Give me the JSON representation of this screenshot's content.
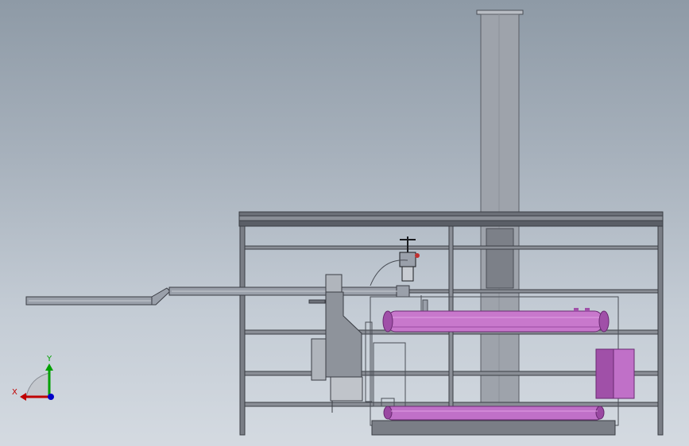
{
  "triad": {
    "x_label": "X",
    "y_label": "Y",
    "x_color": "#c00000",
    "y_color": "#00a000",
    "z_color": "#0000c8"
  },
  "colors": {
    "background_top": "#8e9aa6",
    "background_bottom": "#d4dae1",
    "steel": "#4a4e56",
    "pipe": "#9aa0aa",
    "tank": "#c070c8",
    "tank_dark": "#8a3c92",
    "chimney": "#9ea3ab"
  }
}
